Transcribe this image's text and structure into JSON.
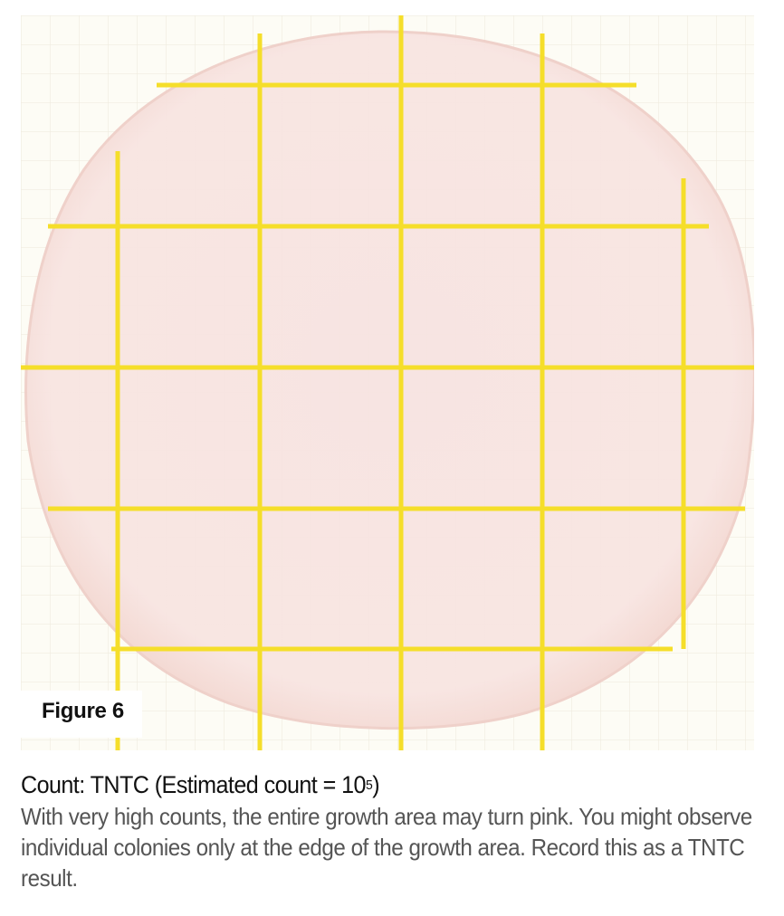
{
  "figure": {
    "label": "Figure 6",
    "colors": {
      "plate_background": "#fdfcf5",
      "fine_grid": "#ede9dc",
      "growth_area": "#f8e4e2",
      "growth_edge": "#efcfc8",
      "grid_lines": "#f5de2a"
    }
  },
  "caption": {
    "title_prefix": "Count: TNTC (Estimated count = 10",
    "title_superscript": "5",
    "title_suffix": ")",
    "body": "With very high counts, the entire growth area may turn pink. You might observe individual colonies only at the edge of the growth area. Record this as a TNTC result."
  }
}
